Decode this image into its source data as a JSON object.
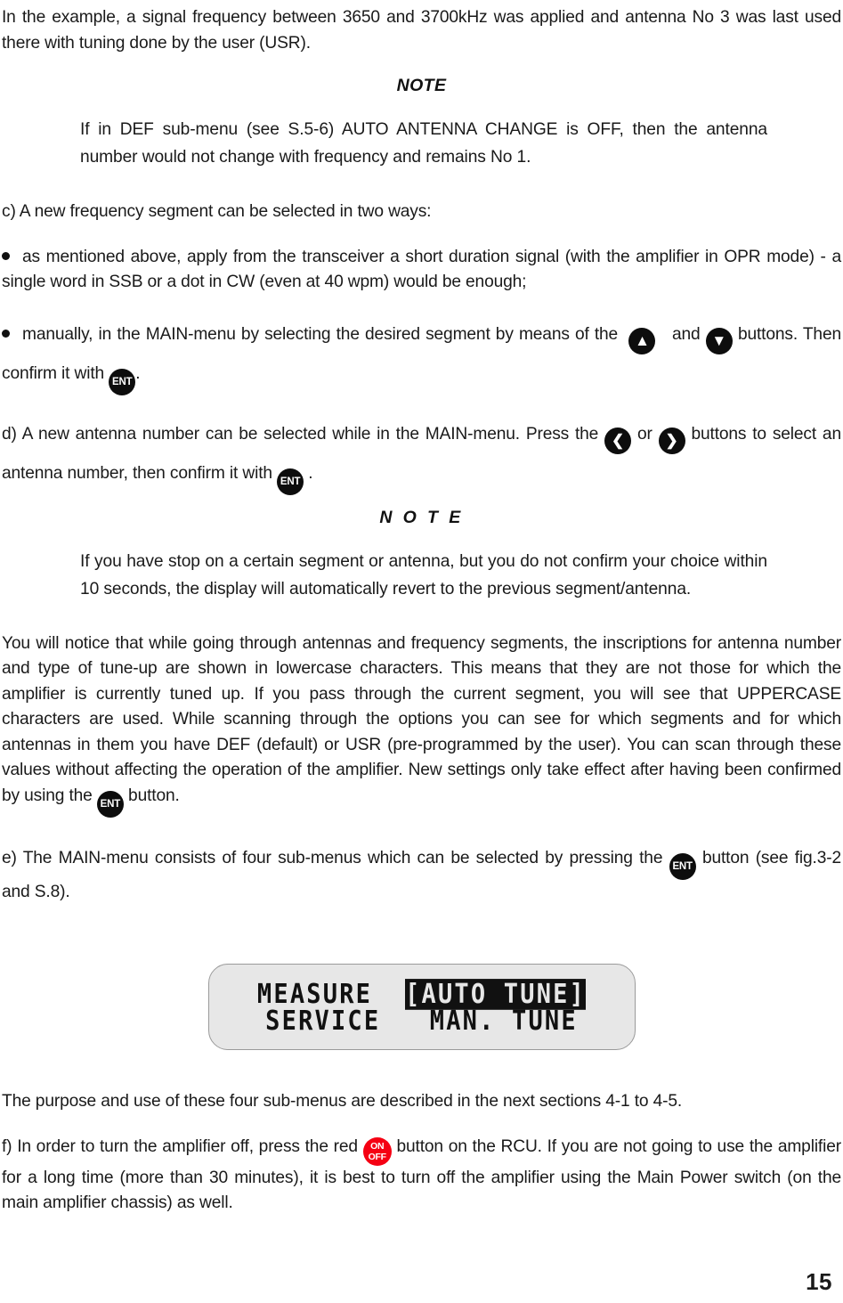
{
  "document": {
    "page_number": "15"
  },
  "paragraphs": {
    "intro": "In the example, a signal frequency between 3650 and 3700kHz was applied and antenna No 3 was last used there with tuning done by the user (USR).",
    "note1_heading": "NOTE",
    "note1_body": "If in DEF sub-menu (see S.5-6) AUTO ANTENNA CHANGE is OFF, then the antenna number would not change with frequency and remains No 1.",
    "item_c": "c) A new frequency segment can be selected in two ways:",
    "bullet1": "as mentioned above, apply from the transceiver a short duration signal (with the amplifier in OPR mode) - a single word in SSB or a dot in CW (even at 40 wpm) would be enough;",
    "bullet2_part1": "manually, in the MAIN-menu by selecting the desired segment by means of the",
    "bullet2_and": "and",
    "bullet2_part2": "buttons. Then confirm it  with",
    "bullet2_end": ".",
    "item_d_part1": "d) A new antenna number can be selected while in the MAIN-menu. Press the",
    "item_d_or": "or",
    "item_d_part2": "buttons to select an antenna number, then confirm it with",
    "item_d_end": ".",
    "note2_heading": "N O T E",
    "note2_body": "If you have stop on a certain segment or antenna, but you do not confirm your choice within 10 seconds, the display will automatically revert to the previous segment/antenna.",
    "long_para_part1": "You will notice that while going through antennas and frequency segments, the inscriptions for antenna number and type of tune-up are shown in lowercase characters. This means that they are not those for which the amplifier is currently tuned up. If you pass through the current segment, you will see that UPPERCASE characters are used. While scanning through the options you can see for which segments and for which antennas in them you have DEF (default) or USR (pre-programmed by the user). You can scan through these values without affecting the operation of the amplifier. New settings only take effect after having been confirmed by using the",
    "long_para_part2": "button.",
    "item_e_part1": "e) The MAIN-menu consists of four sub-menus which can be selected by pressing the",
    "item_e_part2": "button (see fig.3-2 and S.8).",
    "purpose": "The purpose and use of these four sub-menus are described in the next sections 4-1 to 4-5.",
    "item_f_part1": "f) In order to turn the amplifier off, press the red",
    "item_f_part2": "button on the RCU. If you are not going to use the amplifier for a long time (more than 30 minutes), it is best to turn off the amplifier using the Main Power switch (on the main amplifier chassis) as well."
  },
  "keys": {
    "ent_label": "ENT",
    "up_glyph": "▲",
    "down_glyph": "▼",
    "left_glyph": "❮",
    "right_glyph": "❯",
    "power_on": "ON",
    "power_off": "OFF"
  },
  "lcd_display": {
    "line1_left": "MEASURE",
    "line1_selected": "[AUTO TUNE]",
    "line1_full": "MEASURE  [AUTO TUNE]",
    "line2_full": "SERVICE   MAN. TUNE",
    "line2_left": "SERVICE",
    "line2_right": "MAN. TUNE",
    "background_color": "#e7e7e7",
    "text_color": "#111111"
  },
  "colors": {
    "power_button_red": "#f50013",
    "key_black": "#0d0d0d",
    "text": "#1a1a1a",
    "lcd_bg": "#e7e7e7",
    "lcd_border": "#9a9a9a"
  }
}
